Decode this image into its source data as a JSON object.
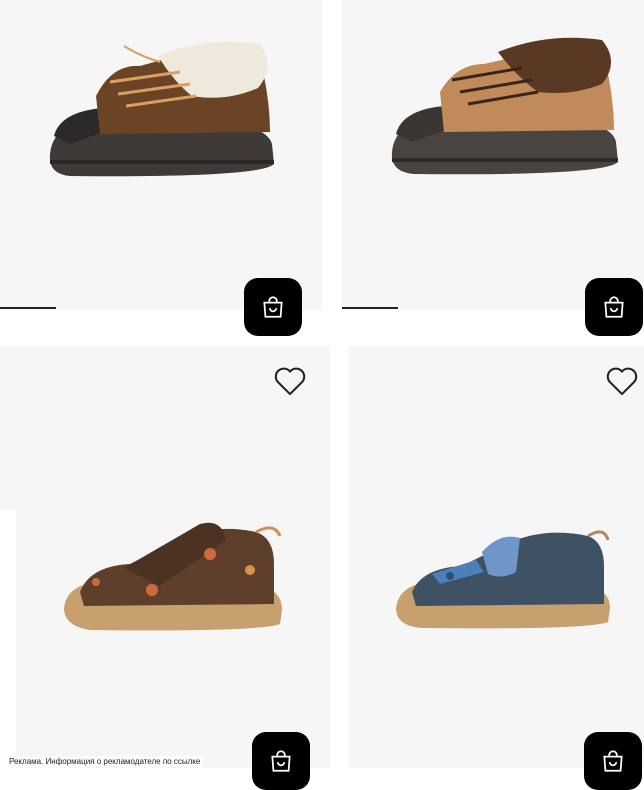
{
  "products": [
    {
      "id": "p1",
      "image": "brown-sherpa-sneaker-with-cream-collar",
      "cart_icon": "shopping-bag-icon"
    },
    {
      "id": "p2",
      "image": "tan-sherpa-sneaker-with-brown-collar",
      "cart_icon": "shopping-bag-icon"
    },
    {
      "id": "p3",
      "image": "brown-velcro-shoe-with-flower-print",
      "fav_icon": "heart-icon",
      "cart_icon": "shopping-bag-icon"
    },
    {
      "id": "p4",
      "image": "navy-velcro-shoe-with-blue-strap",
      "fav_icon": "heart-icon",
      "cart_icon": "shopping-bag-icon"
    }
  ],
  "footer": {
    "ad_text": "Реклама. Информация о рекламодателе по ссылке"
  },
  "colors": {
    "card_bg": "#f6f6f6",
    "button_bg": "#000000",
    "icon_stroke": "#ffffff",
    "heart_stroke": "#222222"
  }
}
